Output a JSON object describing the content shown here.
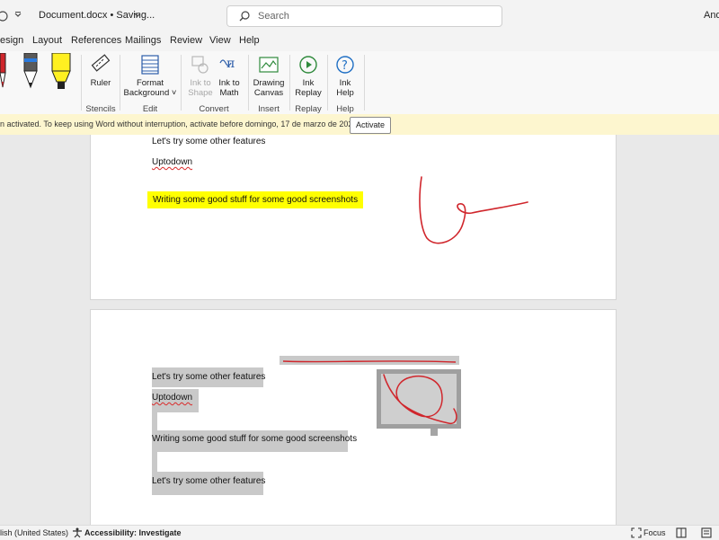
{
  "titlebar": {
    "doc_title": "Document.docx • Saving...",
    "search_placeholder": "Search",
    "user_name": "And"
  },
  "menu": [
    "esign",
    "Layout",
    "References",
    "Mailings",
    "Review",
    "View",
    "Help"
  ],
  "ribbon": {
    "ruler": "Ruler",
    "format_bg_1": "Format",
    "format_bg_2": "Background",
    "ink_shape_1": "Ink to",
    "ink_shape_2": "Shape",
    "ink_math_1": "Ink to",
    "ink_math_2": "Math",
    "drawing_canvas_1": "Drawing",
    "drawing_canvas_2": "Canvas",
    "ink_replay_1": "Ink",
    "ink_replay_2": "Replay",
    "ink_help_1": "Ink",
    "ink_help_2": "Help",
    "groups": {
      "stencils": "Stencils",
      "edit": "Edit",
      "convert": "Convert",
      "insert": "Insert",
      "replay": "Replay",
      "help": "Help"
    }
  },
  "notification": {
    "message": "n activated. To keep using Word without interruption, activate before domingo, 17 de marzo de 2024.",
    "button": "Activate"
  },
  "page1": {
    "line1": "Let's try some other features",
    "line2": "Uptodown",
    "line3": "Writing some good stuff for some good screenshots"
  },
  "page2": {
    "line1": "Let's try some other features",
    "line2": "Uptodown",
    "line3": "Writing some good stuff for some good screenshots",
    "line4": "Let's try some other features"
  },
  "statusbar": {
    "language": "lish (United States)",
    "accessibility": "Accessibility: Investigate",
    "focus": "Focus"
  },
  "colors": {
    "ink_red": "#d0262c",
    "highlight": "#ffff00",
    "notify_bg": "#fdf6cf"
  }
}
